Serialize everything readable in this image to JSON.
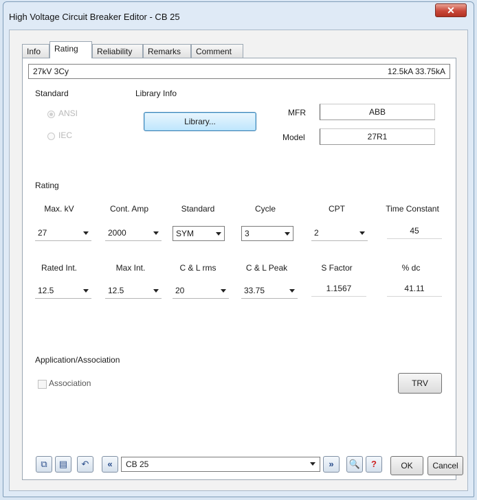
{
  "window": {
    "title": "High Voltage Circuit Breaker Editor - CB 25",
    "close_glyph": "✕"
  },
  "tabs": [
    {
      "label": "Info"
    },
    {
      "label": "Rating"
    },
    {
      "label": "Reliability"
    },
    {
      "label": "Remarks"
    },
    {
      "label": "Comment"
    }
  ],
  "summary": {
    "left": "27kV 3Cy",
    "right": "12.5kA 33.75kA"
  },
  "standard": {
    "label": "Standard",
    "ansi": "ANSI",
    "iec": "IEC",
    "selected": "ANSI"
  },
  "library": {
    "label": "Library Info",
    "button": "Library..."
  },
  "mfr": {
    "label": "MFR",
    "value": "ABB"
  },
  "model": {
    "label": "Model",
    "value": "27R1"
  },
  "rating": {
    "label": "Rating",
    "row1": {
      "headers": [
        "Max. kV",
        "Cont. Amp",
        "Standard",
        "Cycle",
        "CPT",
        "Time Constant"
      ],
      "values": [
        "27",
        "2000",
        "SYM",
        "3",
        "2",
        "45"
      ]
    },
    "row2": {
      "headers": [
        "Rated Int.",
        "Max Int.",
        "C & L rms",
        "C & L Peak",
        "S Factor",
        "% dc"
      ],
      "values": [
        "12.5",
        "12.5",
        "20",
        "33.75",
        "1.1567",
        "41.11"
      ]
    }
  },
  "application": {
    "label": "Application/Association",
    "association": "Association",
    "trv_button": "TRV"
  },
  "bottom": {
    "record": "CB 25",
    "ok": "OK",
    "cancel": "Cancel",
    "help_glyph": "?",
    "prev_glyph": "«",
    "next_glyph": "»"
  }
}
